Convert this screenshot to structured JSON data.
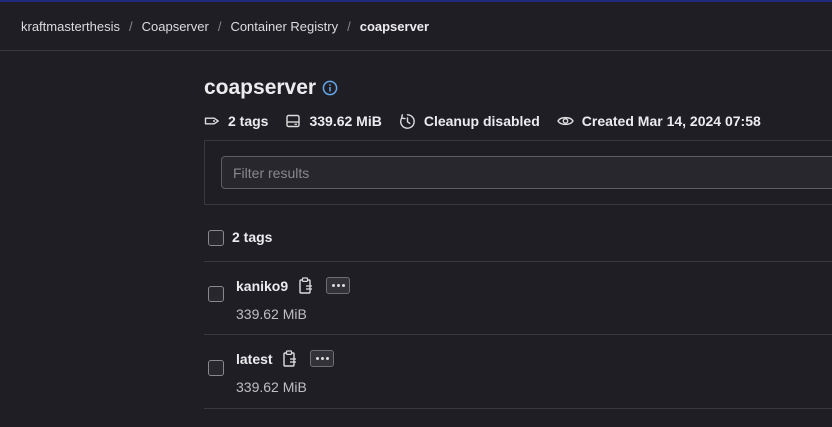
{
  "breadcrumb": [
    "kraftmasterthesis",
    "Coapserver",
    "Container Registry",
    "coapserver"
  ],
  "page": {
    "title": "coapserver",
    "meta": {
      "tags": "2 tags",
      "size": "339.62 MiB",
      "cleanup": "Cleanup disabled",
      "created": "Created Mar 14, 2024 07:58"
    }
  },
  "filter": {
    "placeholder": "Filter results",
    "value": ""
  },
  "list": {
    "header_label": "2 tags",
    "rows": [
      {
        "name": "kaniko9",
        "size": "339.62 MiB"
      },
      {
        "name": "latest",
        "size": "339.62 MiB"
      }
    ]
  },
  "icons": {
    "info": "info-icon",
    "tag": "tag-icon",
    "disk": "disk-icon",
    "cleanup": "clock-icon",
    "created": "eye-icon",
    "copy": "clipboard-icon",
    "more": "ellipsis-icon"
  },
  "colors": {
    "background": "#1f1e24",
    "accent_info": "#63a6e9",
    "text": "#ececef",
    "muted": "#bfbfc3"
  }
}
